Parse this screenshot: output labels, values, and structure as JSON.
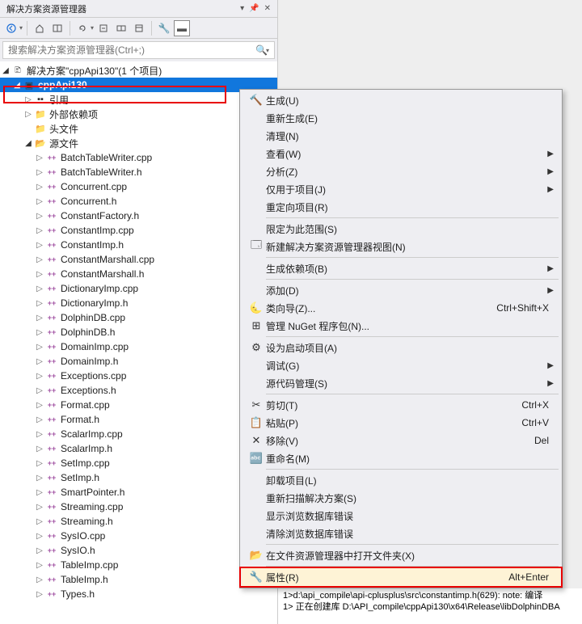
{
  "panel": {
    "title": "解决方案资源管理器"
  },
  "search": {
    "placeholder": "搜索解决方案资源管理器(Ctrl+;)"
  },
  "tree": {
    "solution": {
      "label": "解决方案\"cppApi130\"(1 个项目)"
    },
    "project": {
      "label": "cppApi130"
    },
    "references": {
      "label": "引用"
    },
    "externalDeps": {
      "label": "外部依赖项"
    },
    "headers": {
      "label": "头文件"
    },
    "sources": {
      "label": "源文件"
    },
    "files": [
      "BatchTableWriter.cpp",
      "BatchTableWriter.h",
      "Concurrent.cpp",
      "Concurrent.h",
      "ConstantFactory.h",
      "ConstantImp.cpp",
      "ConstantImp.h",
      "ConstantMarshall.cpp",
      "ConstantMarshall.h",
      "DictionaryImp.cpp",
      "DictionaryImp.h",
      "DolphinDB.cpp",
      "DolphinDB.h",
      "DomainImp.cpp",
      "DomainImp.h",
      "Exceptions.cpp",
      "Exceptions.h",
      "Format.cpp",
      "Format.h",
      "ScalarImp.cpp",
      "ScalarImp.h",
      "SetImp.cpp",
      "SetImp.h",
      "SmartPointer.h",
      "Streaming.cpp",
      "Streaming.h",
      "SysIO.cpp",
      "SysIO.h",
      "TableImp.cpp",
      "TableImp.h",
      "Types.h"
    ]
  },
  "ctx": {
    "items": [
      {
        "icon": "build",
        "label": "生成(U)",
        "shortcut": "",
        "sub": false
      },
      {
        "icon": "",
        "label": "重新生成(E)",
        "shortcut": "",
        "sub": false
      },
      {
        "icon": "",
        "label": "清理(N)",
        "shortcut": "",
        "sub": false
      },
      {
        "icon": "",
        "label": "查看(W)",
        "shortcut": "",
        "sub": true
      },
      {
        "icon": "",
        "label": "分析(Z)",
        "shortcut": "",
        "sub": true
      },
      {
        "icon": "",
        "label": "仅用于项目(J)",
        "shortcut": "",
        "sub": true
      },
      {
        "icon": "",
        "label": "重定向项目(R)",
        "shortcut": "",
        "sub": false
      },
      {
        "sep": true
      },
      {
        "icon": "",
        "label": "限定为此范围(S)",
        "shortcut": "",
        "sub": false
      },
      {
        "icon": "newview",
        "label": "新建解决方案资源管理器视图(N)",
        "shortcut": "",
        "sub": false
      },
      {
        "sep": true
      },
      {
        "icon": "",
        "label": "生成依赖项(B)",
        "shortcut": "",
        "sub": true
      },
      {
        "sep": true
      },
      {
        "icon": "",
        "label": "添加(D)",
        "shortcut": "",
        "sub": true
      },
      {
        "icon": "wizard",
        "label": "类向导(Z)...",
        "shortcut": "Ctrl+Shift+X",
        "sub": false
      },
      {
        "icon": "nuget",
        "label": "管理 NuGet 程序包(N)...",
        "shortcut": "",
        "sub": false
      },
      {
        "sep": true
      },
      {
        "icon": "startup",
        "label": "设为启动项目(A)",
        "shortcut": "",
        "sub": false
      },
      {
        "icon": "",
        "label": "调试(G)",
        "shortcut": "",
        "sub": true
      },
      {
        "icon": "",
        "label": "源代码管理(S)",
        "shortcut": "",
        "sub": true
      },
      {
        "sep": true
      },
      {
        "icon": "cut",
        "label": "剪切(T)",
        "shortcut": "Ctrl+X",
        "sub": false
      },
      {
        "icon": "paste",
        "label": "粘贴(P)",
        "shortcut": "Ctrl+V",
        "sub": false
      },
      {
        "icon": "remove",
        "label": "移除(V)",
        "shortcut": "Del",
        "sub": false
      },
      {
        "icon": "rename",
        "label": "重命名(M)",
        "shortcut": "",
        "sub": false
      },
      {
        "sep": true
      },
      {
        "icon": "",
        "label": "卸载项目(L)",
        "shortcut": "",
        "sub": false
      },
      {
        "icon": "",
        "label": "重新扫描解决方案(S)",
        "shortcut": "",
        "sub": false
      },
      {
        "icon": "",
        "label": "显示浏览数据库错误",
        "shortcut": "",
        "sub": false
      },
      {
        "icon": "",
        "label": "清除浏览数据库错误",
        "shortcut": "",
        "sub": false
      },
      {
        "sep": true
      },
      {
        "icon": "folder",
        "label": "在文件资源管理器中打开文件夹(X)",
        "shortcut": "",
        "sub": false
      },
      {
        "sep": true
      },
      {
        "icon": "wrench",
        "label": "属性(R)",
        "shortcut": "Alt+Enter",
        "sub": false,
        "hl": true
      }
    ]
  },
  "output": {
    "line1": "1>d:\\api_compile\\api-cplusplus\\src\\constantimp.h(629): note: 编译",
    "line2": "1>  正在创建库 D:\\API_compile\\cppApi130\\x64\\Release\\libDolphinDBA"
  }
}
